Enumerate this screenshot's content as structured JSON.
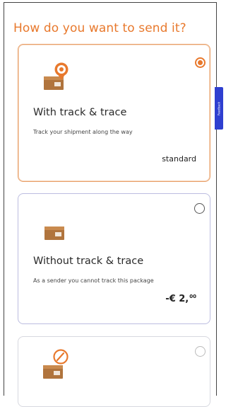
{
  "header": {
    "title": "How do you want to send it?"
  },
  "options": [
    {
      "title": "With track & trace",
      "description": "Track your shipment along the way",
      "price": "standard",
      "selected": true,
      "icon": "package-location-pin-icon"
    },
    {
      "title": "Without track & trace",
      "description": "As a sender you cannot track this package",
      "price_main": "-€ 2,",
      "price_cents": "00",
      "selected": false,
      "icon": "package-icon"
    },
    {
      "selected": false,
      "icon": "package-signature-icon"
    }
  ],
  "feedback": {
    "label": "Feedback"
  },
  "colors": {
    "accent": "#e8792d",
    "selected_border": "#e8a06a",
    "card_border": "#bcbde0",
    "feedback_tab": "#2f3fd0"
  }
}
